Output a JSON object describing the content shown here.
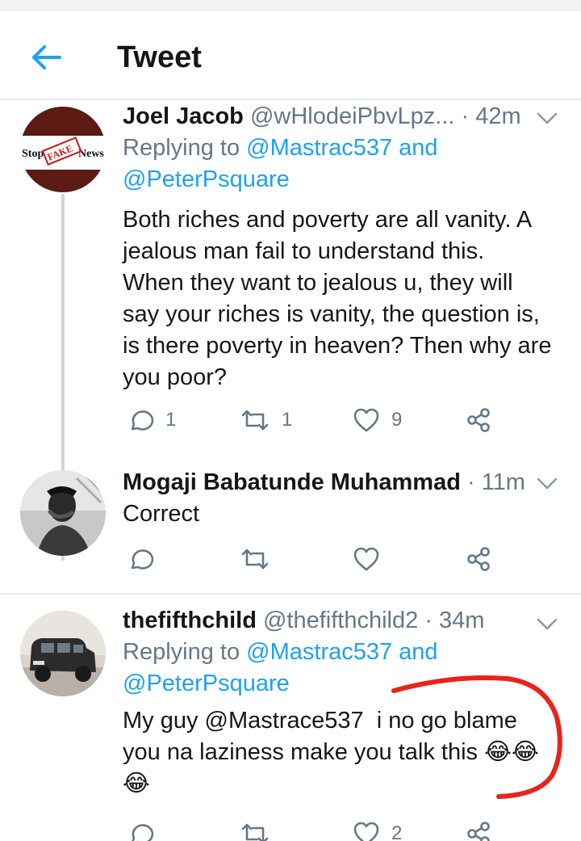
{
  "header": {
    "title": "Tweet"
  },
  "tweets": [
    {
      "name": "Joel Jacob",
      "handle": "@wHlodeiPbvLpz...",
      "time": "· 42m",
      "reply_prefix": "Replying to ",
      "reply_link1": "@Mastrac537 and",
      "reply_link2": "@PeterPsquare",
      "lines": [
        "Both riches and poverty are all vanity. A",
        "jealous man fail to understand this.",
        "When they want to jealous u, they will",
        "say your riches is vanity, the question is,",
        "is there poverty in heaven? Then why are",
        "you poor?"
      ],
      "avatar_texts": {
        "left": "Stop",
        "stamp": "FAKE",
        "right": "News"
      },
      "counts": {
        "replies": "1",
        "retweets": "1",
        "likes": "9"
      }
    },
    {
      "name": "Mogaji Babatunde Muhammad",
      "time": "· 11m",
      "text": "Correct"
    },
    {
      "name": "thefifthchild",
      "handle": "@thefifthchild2",
      "time": "· 34m",
      "reply_prefix": "Replying to ",
      "reply_link1": "@Mastrac537 and",
      "reply_link2": "@PeterPsquare",
      "line1_prefix": "My guy ",
      "line1_mention": "@Mastrace537",
      "line1_suffix": "  i no go blame",
      "line2": "you na laziness make you talk this ",
      "emoji": "😂",
      "counts": {
        "likes": "2"
      }
    }
  ],
  "colors": {
    "accent": "#1da1f2",
    "icon_gray": "#657786",
    "text": "#14171a",
    "annotation": "#e8231c"
  }
}
